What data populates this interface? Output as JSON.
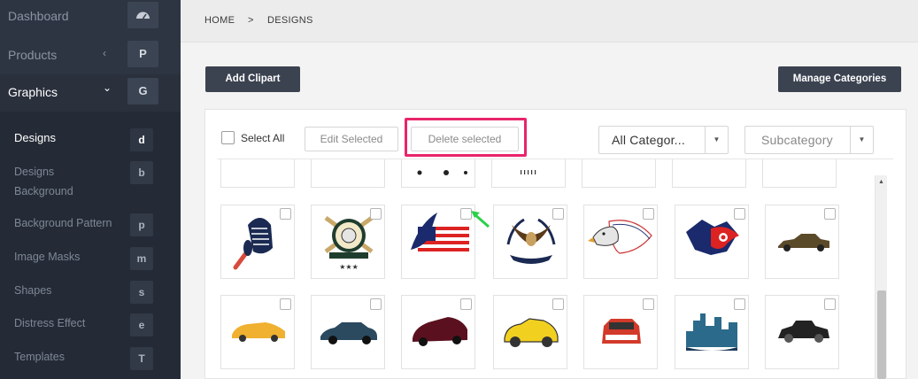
{
  "sidebar": {
    "top_items": [
      {
        "label": "Dashboard",
        "badge_icon": "dashboard-gauge-icon"
      },
      {
        "label": "Products",
        "chevron": "‹",
        "badge": "P"
      },
      {
        "label": "Graphics",
        "chevron": "⌄",
        "badge": "G"
      }
    ],
    "sub_items": [
      {
        "label": "Designs",
        "badge": "d"
      },
      {
        "label": "Designs",
        "label2": "Background",
        "badge": "b"
      },
      {
        "label": "Background Pattern",
        "badge": "p"
      },
      {
        "label": "Image Masks",
        "badge": "m"
      },
      {
        "label": "Shapes",
        "badge": "s"
      },
      {
        "label": "Distress Effect",
        "badge": "e"
      },
      {
        "label": "Templates",
        "badge": "T"
      }
    ]
  },
  "breadcrumb": {
    "home": "HOME",
    "separator": ">",
    "current": "DESIGNS"
  },
  "toolbar": {
    "add_clipart": "Add Clipart",
    "manage_categories": "Manage Categories"
  },
  "filters": {
    "select_all": "Select All",
    "edit_selected": "Edit Selected",
    "delete_selected": "Delete selected",
    "category_value": "All Categor...",
    "subcategory_placeholder": "Subcategory"
  },
  "grid": {
    "row1": [
      "baseball-glove-bat-clipart",
      "baseball-emblem-clipart",
      "eagle-flag-clipart",
      "eagle-wreath-clipart",
      "eagle-head-flag-clipart",
      "flaming-star-clipart",
      "classic-car-clipart"
    ],
    "row2": [
      "sports-car-clipart",
      "sedan-car-clipart",
      "muscle-car-clipart",
      "cartoon-car-clipart",
      "red-car-front-clipart",
      "city-skyline-clipart",
      "vintage-car-clipart"
    ]
  },
  "colors": {
    "sidebar_bg": "#2c3340",
    "accent_highlight": "#e8246a",
    "button_dark": "#3b4250",
    "arrow_green": "#2bd14a"
  }
}
